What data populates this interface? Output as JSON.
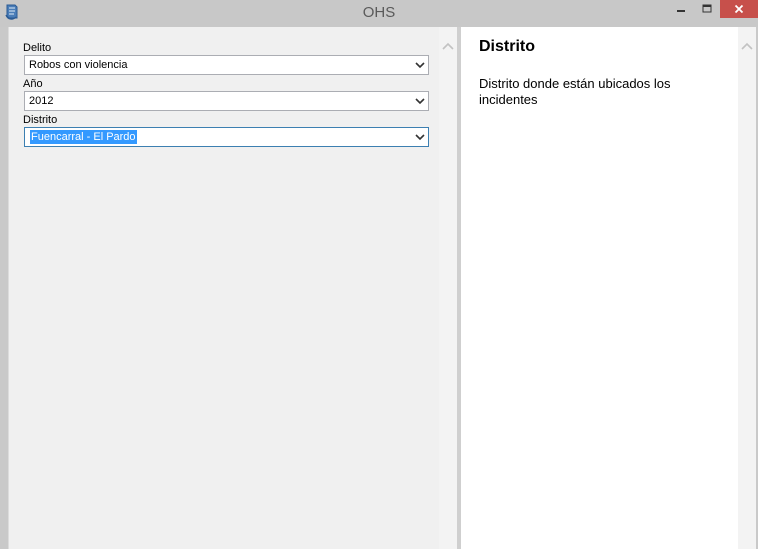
{
  "window": {
    "title": "OHS",
    "colors": {
      "titlebar": "#c8c8c8",
      "close_button": "#c7504b",
      "selection": "#3399ff"
    }
  },
  "form": {
    "fields": [
      {
        "label": "Delito",
        "value": "Robos con violencia",
        "focused": false
      },
      {
        "label": "Año",
        "value": "2012",
        "focused": false
      },
      {
        "label": "Distrito",
        "value": "Fuencarral - El Pardo",
        "focused": true
      }
    ]
  },
  "help": {
    "title": "Distrito",
    "description": "Distrito donde están ubicados los incidentes"
  },
  "icons": {
    "app": "app-document-icon",
    "minimize": "minimize-icon",
    "maximize": "maximize-icon",
    "close": "close-icon",
    "dropdown": "chevron-down-icon",
    "scroll_up": "chevron-up-icon"
  }
}
